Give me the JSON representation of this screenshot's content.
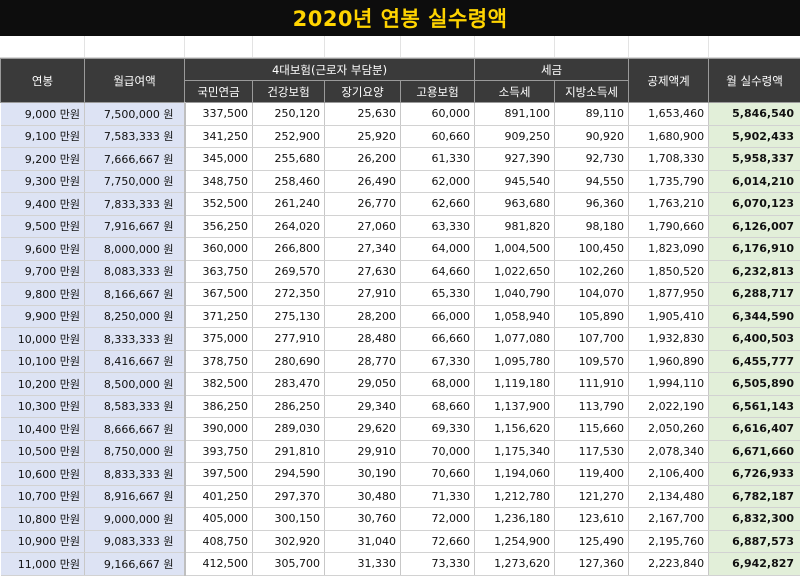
{
  "title": "2020년 연봉 실수령액",
  "colors": {
    "title_bg": "#0d0d0d",
    "title_fg": "#ffd400",
    "header_bg": "#3a3a3a",
    "annual_bg": "#dde3f4",
    "net_bg": "#e2efd9"
  },
  "headers": {
    "annual": "연봉",
    "monthly": "월급여액",
    "insurance_group": "4대보험(근로자 부담분)",
    "pension": "국민연금",
    "health": "건강보험",
    "ltc": "장기요양",
    "employment": "고용보험",
    "tax_group": "세금",
    "income_tax": "소득세",
    "local_tax": "지방소득세",
    "deduction_total": "공제액계",
    "net_monthly": "월 실수령액"
  },
  "rows": [
    [
      "9,000 만원",
      "7,500,000 원",
      "337,500",
      "250,120",
      "25,630",
      "60,000",
      "891,100",
      "89,110",
      "1,653,460",
      "5,846,540"
    ],
    [
      "9,100 만원",
      "7,583,333 원",
      "341,250",
      "252,900",
      "25,920",
      "60,660",
      "909,250",
      "90,920",
      "1,680,900",
      "5,902,433"
    ],
    [
      "9,200 만원",
      "7,666,667 원",
      "345,000",
      "255,680",
      "26,200",
      "61,330",
      "927,390",
      "92,730",
      "1,708,330",
      "5,958,337"
    ],
    [
      "9,300 만원",
      "7,750,000 원",
      "348,750",
      "258,460",
      "26,490",
      "62,000",
      "945,540",
      "94,550",
      "1,735,790",
      "6,014,210"
    ],
    [
      "9,400 만원",
      "7,833,333 원",
      "352,500",
      "261,240",
      "26,770",
      "62,660",
      "963,680",
      "96,360",
      "1,763,210",
      "6,070,123"
    ],
    [
      "9,500 만원",
      "7,916,667 원",
      "356,250",
      "264,020",
      "27,060",
      "63,330",
      "981,820",
      "98,180",
      "1,790,660",
      "6,126,007"
    ],
    [
      "9,600 만원",
      "8,000,000 원",
      "360,000",
      "266,800",
      "27,340",
      "64,000",
      "1,004,500",
      "100,450",
      "1,823,090",
      "6,176,910"
    ],
    [
      "9,700 만원",
      "8,083,333 원",
      "363,750",
      "269,570",
      "27,630",
      "64,660",
      "1,022,650",
      "102,260",
      "1,850,520",
      "6,232,813"
    ],
    [
      "9,800 만원",
      "8,166,667 원",
      "367,500",
      "272,350",
      "27,910",
      "65,330",
      "1,040,790",
      "104,070",
      "1,877,950",
      "6,288,717"
    ],
    [
      "9,900 만원",
      "8,250,000 원",
      "371,250",
      "275,130",
      "28,200",
      "66,000",
      "1,058,940",
      "105,890",
      "1,905,410",
      "6,344,590"
    ],
    [
      "10,000 만원",
      "8,333,333 원",
      "375,000",
      "277,910",
      "28,480",
      "66,660",
      "1,077,080",
      "107,700",
      "1,932,830",
      "6,400,503"
    ],
    [
      "10,100 만원",
      "8,416,667 원",
      "378,750",
      "280,690",
      "28,770",
      "67,330",
      "1,095,780",
      "109,570",
      "1,960,890",
      "6,455,777"
    ],
    [
      "10,200 만원",
      "8,500,000 원",
      "382,500",
      "283,470",
      "29,050",
      "68,000",
      "1,119,180",
      "111,910",
      "1,994,110",
      "6,505,890"
    ],
    [
      "10,300 만원",
      "8,583,333 원",
      "386,250",
      "286,250",
      "29,340",
      "68,660",
      "1,137,900",
      "113,790",
      "2,022,190",
      "6,561,143"
    ],
    [
      "10,400 만원",
      "8,666,667 원",
      "390,000",
      "289,030",
      "29,620",
      "69,330",
      "1,156,620",
      "115,660",
      "2,050,260",
      "6,616,407"
    ],
    [
      "10,500 만원",
      "8,750,000 원",
      "393,750",
      "291,810",
      "29,910",
      "70,000",
      "1,175,340",
      "117,530",
      "2,078,340",
      "6,671,660"
    ],
    [
      "10,600 만원",
      "8,833,333 원",
      "397,500",
      "294,590",
      "30,190",
      "70,660",
      "1,194,060",
      "119,400",
      "2,106,400",
      "6,726,933"
    ],
    [
      "10,700 만원",
      "8,916,667 원",
      "401,250",
      "297,370",
      "30,480",
      "71,330",
      "1,212,780",
      "121,270",
      "2,134,480",
      "6,782,187"
    ],
    [
      "10,800 만원",
      "9,000,000 원",
      "405,000",
      "300,150",
      "30,760",
      "72,000",
      "1,236,180",
      "123,610",
      "2,167,700",
      "6,832,300"
    ],
    [
      "10,900 만원",
      "9,083,333 원",
      "408,750",
      "302,920",
      "31,040",
      "72,660",
      "1,254,900",
      "125,490",
      "2,195,760",
      "6,887,573"
    ],
    [
      "11,000 만원",
      "9,166,667 원",
      "412,500",
      "305,700",
      "31,330",
      "73,330",
      "1,273,620",
      "127,360",
      "2,223,840",
      "6,942,827"
    ]
  ]
}
